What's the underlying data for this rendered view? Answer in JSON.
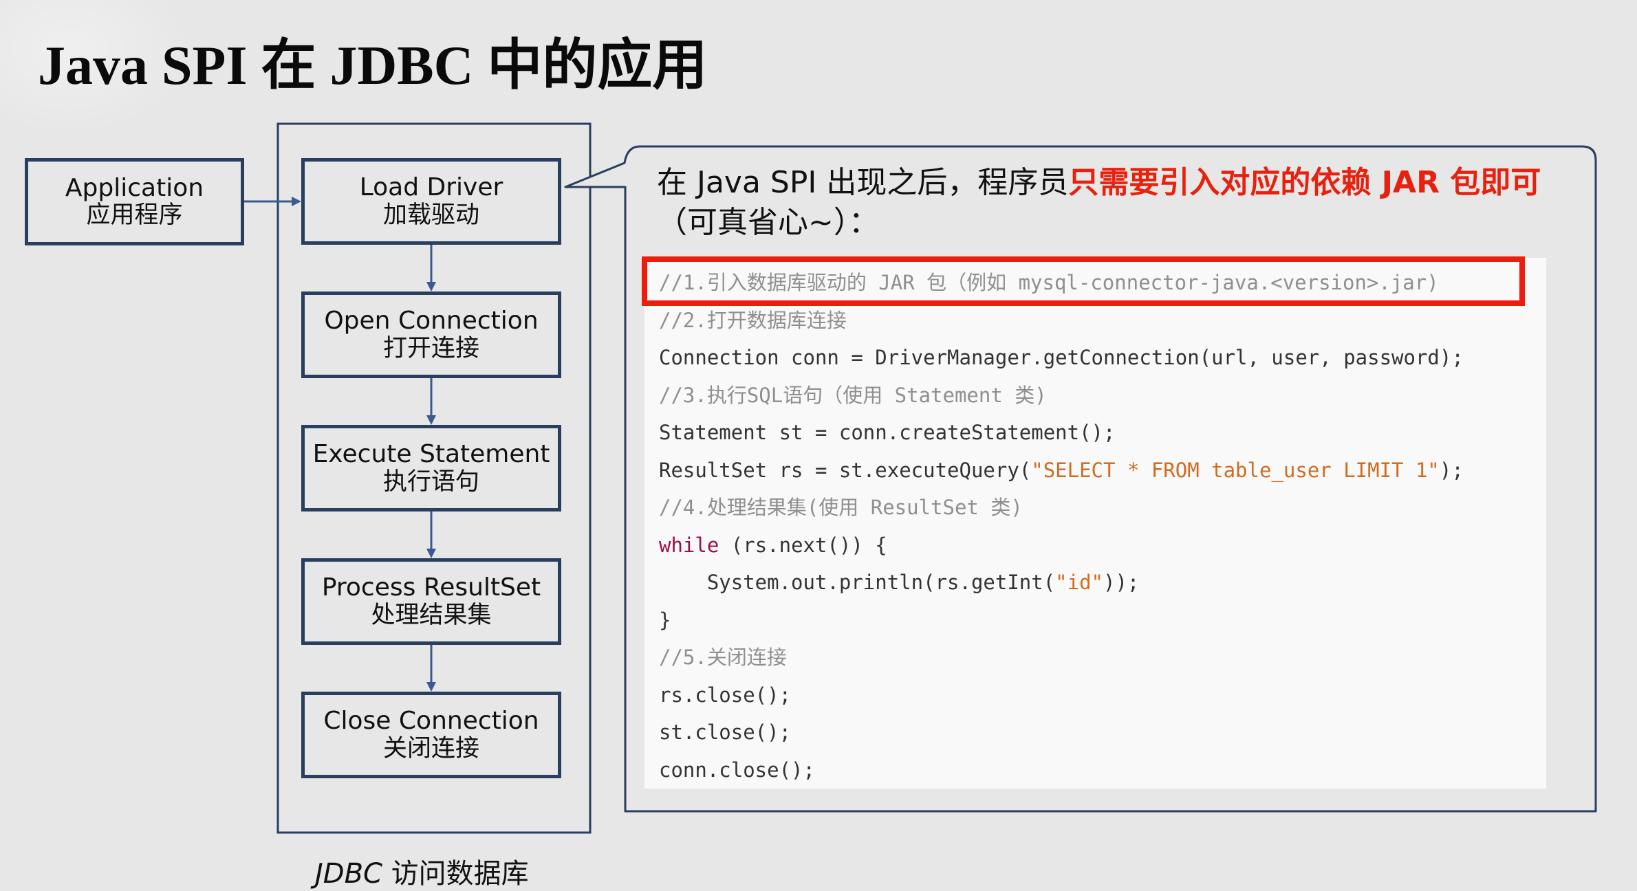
{
  "title": "Java SPI 在 JDBC 中的应用",
  "flow": {
    "app": {
      "en": "Application",
      "zh": "应用程序"
    },
    "steps": [
      {
        "en": "Load Driver",
        "zh": "加载驱动"
      },
      {
        "en": "Open Connection",
        "zh": "打开连接"
      },
      {
        "en": "Execute Statement",
        "zh": "执行语句"
      },
      {
        "en": "Process ResultSet",
        "zh": "处理结果集"
      },
      {
        "en": "Close Connection",
        "zh": "关闭连接"
      }
    ],
    "group_caption_en": "JDBC",
    "group_caption_zh": " 访问数据库"
  },
  "callout": {
    "intro": "在 Java SPI 出现之后，程序员",
    "highlight": "只需要引入对应的依赖 JAR 包即可",
    "outro": "（可真省心~）：",
    "code": [
      {
        "type": "comment",
        "text": "//1.引入数据库驱动的 JAR 包（例如 mysql-connector-java.<version>.jar)"
      },
      {
        "type": "comment",
        "text": "//2.打开数据库连接"
      },
      {
        "type": "code",
        "text": "Connection conn = DriverManager.getConnection(url, user, password);"
      },
      {
        "type": "comment",
        "text": "//3.执行SQL语句（使用 Statement 类)"
      },
      {
        "type": "code",
        "text": "Statement st = conn.createStatement();"
      },
      {
        "type": "mixed",
        "pre": "ResultSet rs = st.executeQuery(",
        "str": "\"SELECT * FROM table_user LIMIT 1\"",
        "post": ");"
      },
      {
        "type": "comment",
        "text": "//4.处理结果集(使用 ResultSet 类)"
      },
      {
        "type": "keyword",
        "kw": "while",
        "post": " (rs.next()) {"
      },
      {
        "type": "mixed",
        "pre": "    System.out.println(rs.getInt(",
        "str": "\"id\"",
        "post": "));"
      },
      {
        "type": "code",
        "text": "}"
      },
      {
        "type": "comment",
        "text": "//5.关闭连接"
      },
      {
        "type": "code",
        "text": "rs.close();"
      },
      {
        "type": "code",
        "text": "st.close();"
      },
      {
        "type": "code",
        "text": "conn.close();"
      }
    ],
    "highlighted_line": 0
  },
  "colors": {
    "box_border": "#2a3e60",
    "arrow": "#3b5a8f",
    "highlight_red": "#e8210f",
    "string_orange": "#d16b1e",
    "keyword": "#9b0f4a",
    "comment": "#8f8f8f"
  }
}
